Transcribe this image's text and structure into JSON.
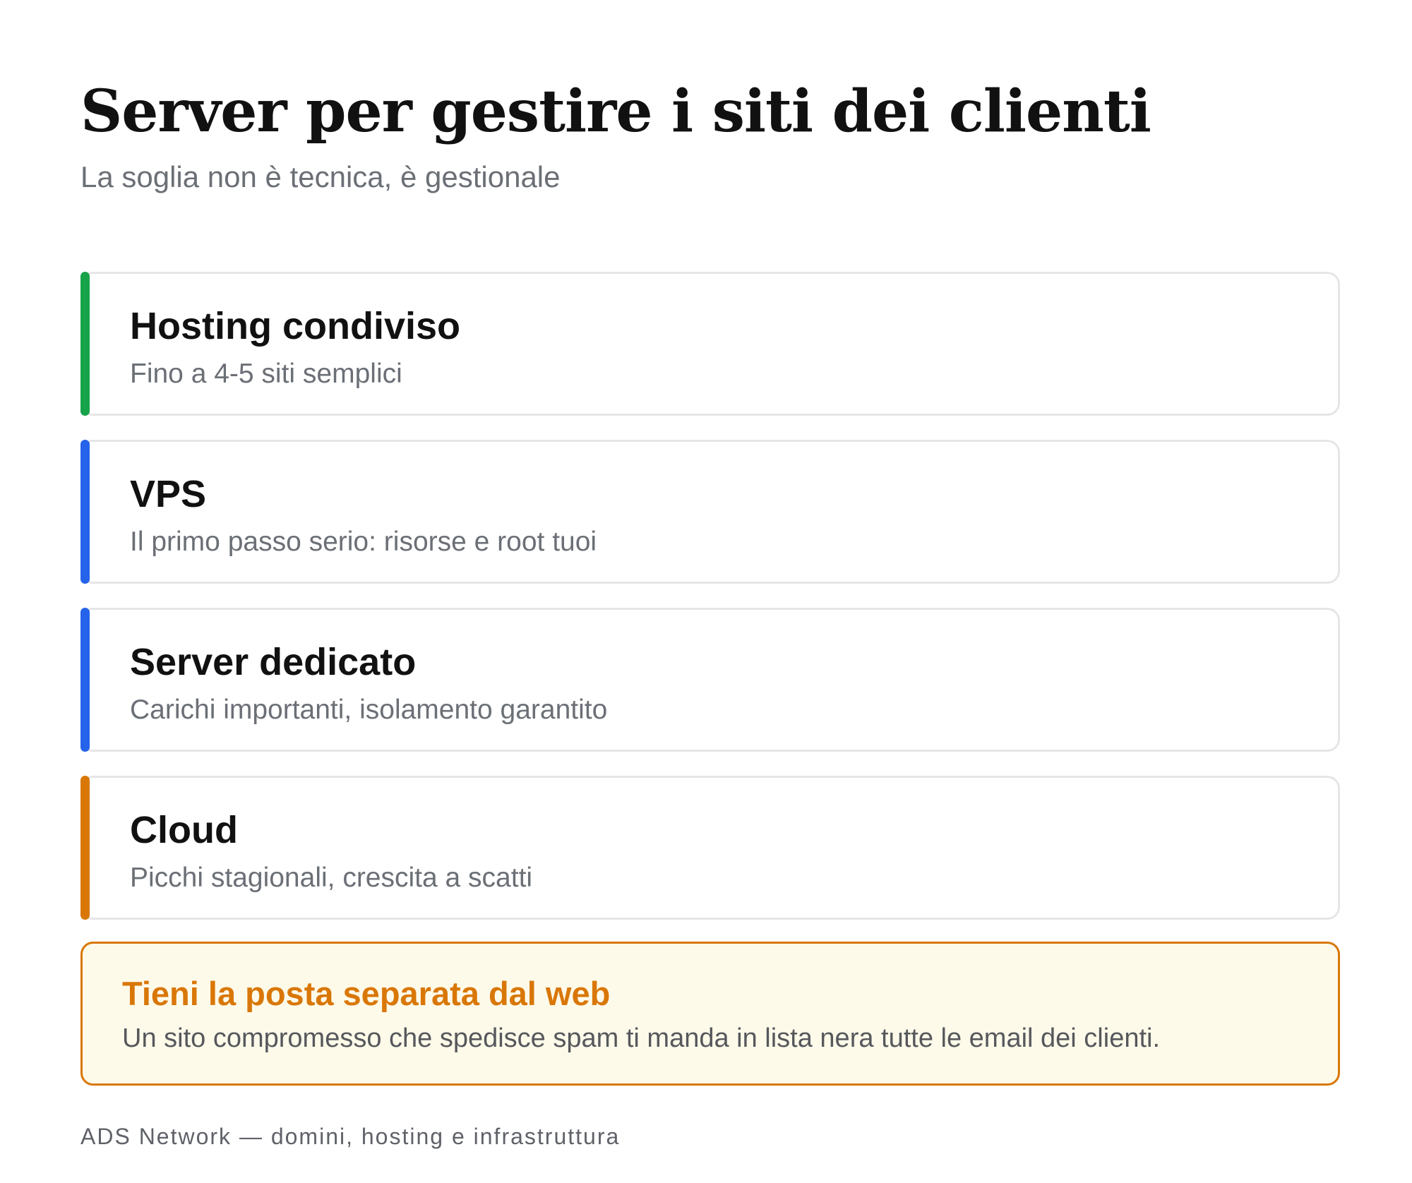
{
  "header": {
    "title": "Server per gestire i siti dei clienti",
    "subtitle": "La soglia non è tecnica, è gestionale"
  },
  "cards": [
    {
      "title": "Hosting condiviso",
      "description": "Fino a 4-5 siti semplici",
      "accent_color": "#16a34a"
    },
    {
      "title": "VPS",
      "description": "Il primo passo serio: risorse e root tuoi",
      "accent_color": "#2563eb"
    },
    {
      "title": "Server dedicato",
      "description": "Carichi importanti, isolamento garantito",
      "accent_color": "#2563eb"
    },
    {
      "title": "Cloud",
      "description": "Picchi stagionali, crescita a scatti",
      "accent_color": "#d97706"
    }
  ],
  "note": {
    "title": "Tieni la posta separata dal web",
    "text": "Un sito compromesso che spedisce spam ti manda in lista nera tutte le email dei clienti.",
    "accent_color": "#d97706",
    "background_color": "#fefaea"
  },
  "footer": {
    "text": "ADS Network — domini, hosting e infrastruttura"
  }
}
